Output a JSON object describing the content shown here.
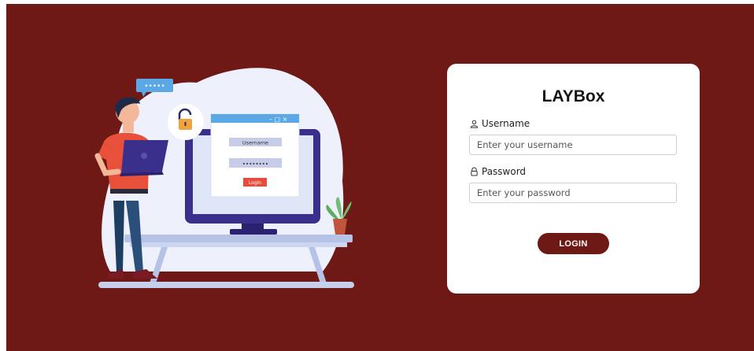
{
  "colors": {
    "background": "#6e1915",
    "card": "#ffffff",
    "accent": "#6e1915",
    "screen_accent": "#e84b3c"
  },
  "illustration": {
    "speech_bubble_dots": "•••••",
    "screen_username_label": "Username",
    "screen_password_mask": "••••••••",
    "screen_login_label": "Login",
    "window_controls": "– ▢ ×",
    "icons": [
      "lock-icon",
      "laptop-icon",
      "plant-icon",
      "monitor-icon"
    ]
  },
  "login_form": {
    "title": "LAYBox",
    "username": {
      "label": "Username",
      "placeholder": "Enter your username",
      "value": "",
      "icon": "user-icon"
    },
    "password": {
      "label": "Password",
      "placeholder": "Enter your password",
      "value": "",
      "icon": "lock-outline-icon"
    },
    "submit_label": "LOGIN"
  }
}
